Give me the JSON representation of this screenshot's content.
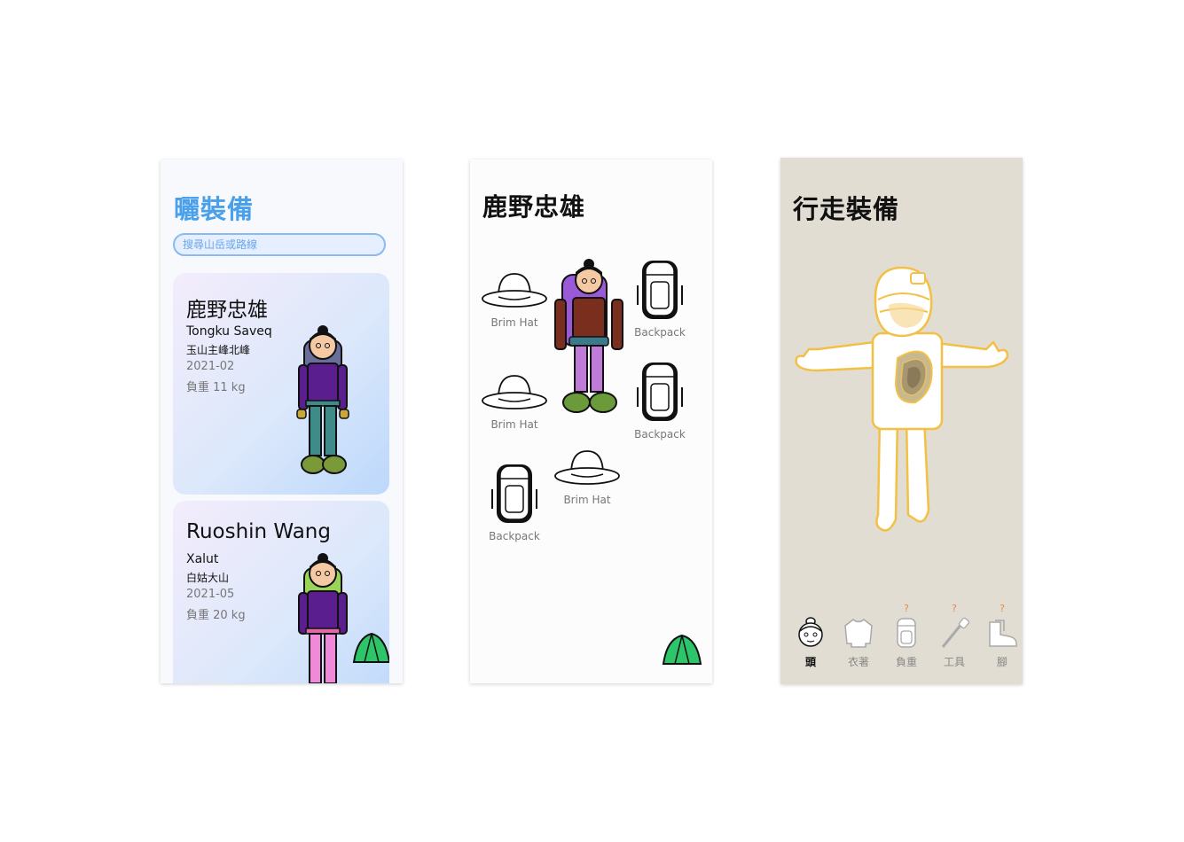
{
  "screen1": {
    "title": "曬裝備",
    "search_placeholder": "搜尋山岳或路線",
    "cards": [
      {
        "name": "鹿野忠雄",
        "subtitle": "Tongku Saveq",
        "mountain": "玉山主峰北峰",
        "date": "2021-02",
        "weight": "負重 11 kg"
      },
      {
        "name": "Ruoshin Wang",
        "subtitle": "Xalut",
        "mountain": "白姑大山",
        "date": "2021-05",
        "weight": "負重 20 kg"
      }
    ]
  },
  "screen2": {
    "title": "鹿野忠雄",
    "items": [
      {
        "label": "Brim Hat",
        "icon": "brim-hat-icon"
      },
      {
        "label": "Backpack",
        "icon": "backpack-icon"
      },
      {
        "label": "Brim Hat",
        "icon": "brim-hat-icon"
      },
      {
        "label": "Backpack",
        "icon": "backpack-icon"
      },
      {
        "label": "Backpack",
        "icon": "backpack-icon"
      },
      {
        "label": "Brim Hat",
        "icon": "brim-hat-icon"
      }
    ]
  },
  "screen3": {
    "title": "行走裝備",
    "tabs": [
      {
        "label": "頭",
        "icon": "head-icon",
        "active": true
      },
      {
        "label": "衣著",
        "icon": "shirt-icon",
        "badge": ""
      },
      {
        "label": "負重",
        "icon": "backpack-icon",
        "badge": "?"
      },
      {
        "label": "工具",
        "icon": "trekking-pole-icon",
        "badge": "?"
      },
      {
        "label": "腳",
        "icon": "boots-icon",
        "badge": "?"
      }
    ]
  },
  "colors": {
    "accent": "#4aa0ea",
    "tent": "#2ec46a",
    "screen3_bg": "#e2ddd2",
    "outline": "#f3c046"
  }
}
